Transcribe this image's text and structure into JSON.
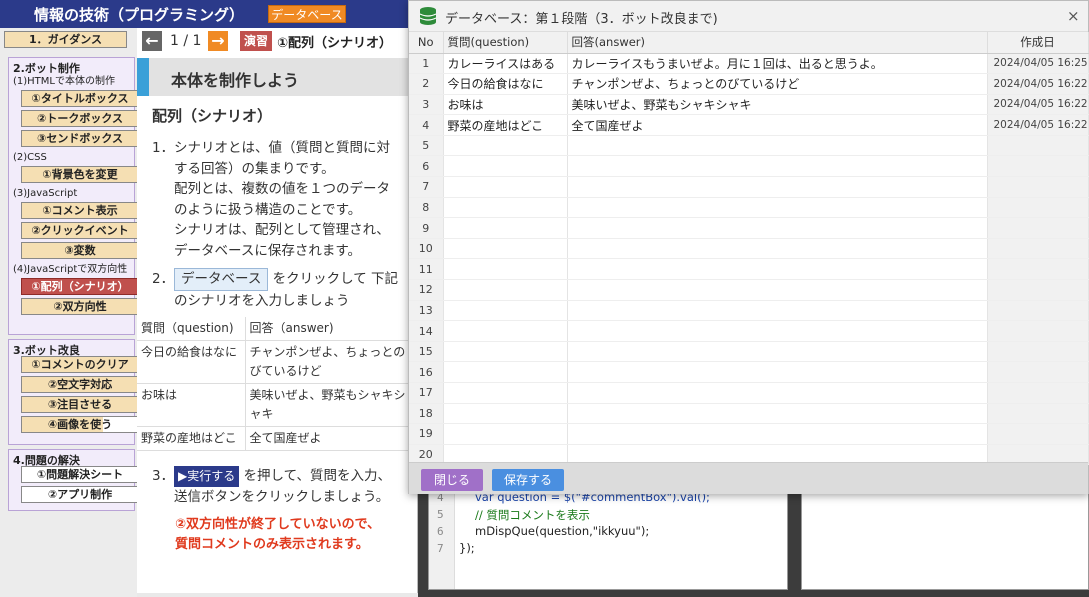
{
  "app": {
    "title": "情報の技術（プログラミング）",
    "db_button": "データベース"
  },
  "sidebar": {
    "guidance": "1．ガイダンス",
    "sec2": {
      "title": "2.ボット制作",
      "sub1": "(1)HTMLで本体の制作",
      "items1": [
        "①タイトルボックス",
        "②トークボックス",
        "③センドボックス"
      ],
      "sub2": "(2)CSS",
      "items2": [
        "①背景色を変更"
      ],
      "sub3": "(3)JavaScript",
      "items3": [
        "①コメント表示",
        "②クリックイベント",
        "③変数"
      ],
      "sub4": "(4)JavaScriptで双方向性",
      "items4": [
        "①配列（シナリオ）",
        "②双方向性"
      ]
    },
    "sec3": {
      "title": "3.ボット改良",
      "items": [
        "①コメントのクリア",
        "②空文字対応",
        "③注目させる",
        "④画像を使う"
      ]
    },
    "sec4": {
      "title": "4.問題の解決",
      "items": [
        "①問題解決シート",
        "②アプリ制作"
      ]
    }
  },
  "lesson": {
    "page": "1 / 1",
    "tag": "演習",
    "topic": "①配列（シナリオ）",
    "band_title": "本体を制作しよう",
    "heading": "配列（シナリオ）",
    "step1_num": "1．",
    "step1_lines": [
      "シナリオとは、値（質問と質問に対",
      "する回答）の集まりです。",
      "配列とは、複数の値を１つのデータ",
      "のように扱う構造のことです。",
      "シナリオは、配列として管理され、",
      "データベースに保存されます。"
    ],
    "step2_num": "2．",
    "step2_chip": "データベース",
    "step2_rest": "をクリックして 下記",
    "step2_line2": "のシナリオを入力しましょう",
    "table": {
      "headers": [
        "質問（question)",
        "回答（answer)"
      ],
      "rows": [
        [
          "今日の給食はなに",
          "チャンポンぜよ、ちょっとのびているけど"
        ],
        [
          "お味は",
          "美味いぜよ、野菜もシャキシャキ"
        ],
        [
          "野菜の産地はどこ",
          "全て国産ぜよ"
        ]
      ]
    },
    "step3_num": "3．",
    "step3_chip": "▶実行する",
    "step3_rest": "を押して、質問を入力、",
    "step3_line2": "送信ボタンをクリックしましょう。",
    "warn1": "②双方向性が終了していないので、",
    "warn2": "質問コメントのみ表示されます。"
  },
  "editor": {
    "lines": [
      {
        "n": "4",
        "text": "var question = $(\"#commentBox\").val();"
      },
      {
        "n": "5",
        "text": "// 質問コメントを表示"
      },
      {
        "n": "6",
        "text": "mDispQue(question,\"ikkyuu\");"
      },
      {
        "n": "7",
        "text": "});"
      }
    ]
  },
  "modal": {
    "title": "データベース：第１段階（3．ボット改良まで)",
    "close": "×",
    "columns": [
      "No",
      "質問(question)",
      "回答(answer)",
      "作成日"
    ],
    "rows": [
      {
        "no": "1",
        "q": "カレーライスはある",
        "a": "カレーライスもうまいぜよ。月に１回は、出ると思うよ。",
        "date": "2024/04/05 16:25"
      },
      {
        "no": "2",
        "q": "今日の給食はなに",
        "a": "チャンポンぜよ、ちょっとのびているけど",
        "date": "2024/04/05 16:22"
      },
      {
        "no": "3",
        "q": "お味は",
        "a": "美味いぜよ、野菜もシャキシャキ",
        "date": "2024/04/05 16:22"
      },
      {
        "no": "4",
        "q": "野菜の産地はどこ",
        "a": "全て国産ぜよ",
        "date": "2024/04/05 16:22"
      },
      {
        "no": "5",
        "q": "",
        "a": "",
        "date": ""
      },
      {
        "no": "6",
        "q": "",
        "a": "",
        "date": ""
      },
      {
        "no": "7",
        "q": "",
        "a": "",
        "date": ""
      },
      {
        "no": "8",
        "q": "",
        "a": "",
        "date": ""
      },
      {
        "no": "9",
        "q": "",
        "a": "",
        "date": ""
      },
      {
        "no": "10",
        "q": "",
        "a": "",
        "date": ""
      },
      {
        "no": "11",
        "q": "",
        "a": "",
        "date": ""
      },
      {
        "no": "12",
        "q": "",
        "a": "",
        "date": ""
      },
      {
        "no": "13",
        "q": "",
        "a": "",
        "date": ""
      },
      {
        "no": "14",
        "q": "",
        "a": "",
        "date": ""
      },
      {
        "no": "15",
        "q": "",
        "a": "",
        "date": ""
      },
      {
        "no": "16",
        "q": "",
        "a": "",
        "date": ""
      },
      {
        "no": "17",
        "q": "",
        "a": "",
        "date": ""
      },
      {
        "no": "18",
        "q": "",
        "a": "",
        "date": ""
      },
      {
        "no": "19",
        "q": "",
        "a": "",
        "date": ""
      },
      {
        "no": "20",
        "q": "",
        "a": "",
        "date": ""
      }
    ],
    "close_button": "閉じる",
    "save_button": "保存する"
  },
  "colors": {
    "topbar": "#2b3a8a",
    "accent_orange": "#f08a24",
    "active_item": "#c0504d",
    "close_button": "#a070c8",
    "save_button": "#4a8fe0",
    "band_accent": "#3aa0d8"
  }
}
